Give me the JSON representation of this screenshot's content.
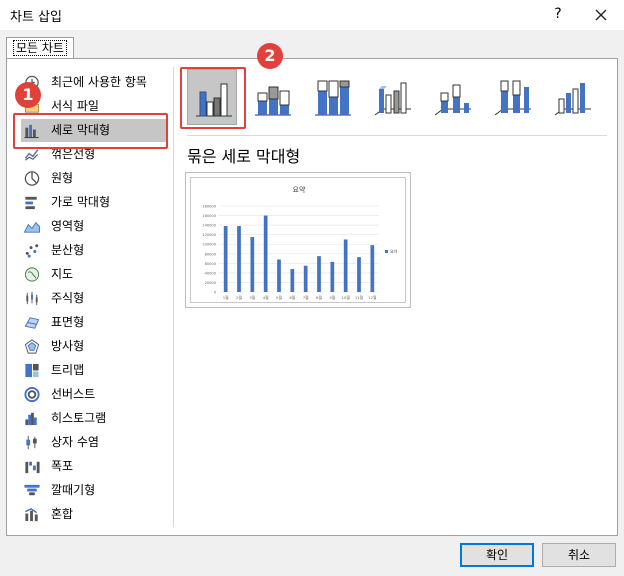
{
  "window": {
    "title": "차트 삽입",
    "help": "?"
  },
  "tabs": [
    {
      "label": "모든 차트",
      "active": true
    }
  ],
  "sidebar": {
    "items": [
      {
        "label": "최근에 사용한 항목",
        "icon": "recent-icon"
      },
      {
        "label": "서식 파일",
        "icon": "template-folder-icon"
      },
      {
        "label": "세로 막대형",
        "icon": "column-chart-icon",
        "selected": true
      },
      {
        "label": "꺾은선형",
        "icon": "line-chart-icon"
      },
      {
        "label": "원형",
        "icon": "pie-chart-icon"
      },
      {
        "label": "가로 막대형",
        "icon": "bar-chart-icon"
      },
      {
        "label": "영역형",
        "icon": "area-chart-icon"
      },
      {
        "label": "분산형",
        "icon": "scatter-chart-icon"
      },
      {
        "label": "지도",
        "icon": "map-chart-icon"
      },
      {
        "label": "주식형",
        "icon": "stock-chart-icon"
      },
      {
        "label": "표면형",
        "icon": "surface-chart-icon"
      },
      {
        "label": "방사형",
        "icon": "radar-chart-icon"
      },
      {
        "label": "트리맵",
        "icon": "treemap-icon"
      },
      {
        "label": "선버스트",
        "icon": "sunburst-icon"
      },
      {
        "label": "히스토그램",
        "icon": "histogram-icon"
      },
      {
        "label": "상자 수염",
        "icon": "box-whisker-icon"
      },
      {
        "label": "폭포",
        "icon": "waterfall-icon"
      },
      {
        "label": "깔때기형",
        "icon": "funnel-icon"
      },
      {
        "label": "혼합",
        "icon": "combo-chart-icon"
      }
    ]
  },
  "callouts": {
    "step1": "1",
    "step2": "2"
  },
  "chart_subtypes": {
    "selected_title": "묶은 세로 막대형",
    "items": [
      {
        "icon": "clustered-column-icon",
        "selected": true
      },
      {
        "icon": "stacked-column-icon"
      },
      {
        "icon": "100-stacked-column-icon"
      },
      {
        "icon": "3d-clustered-column-icon"
      },
      {
        "icon": "3d-stacked-column-icon"
      },
      {
        "icon": "3d-100-stacked-column-icon"
      },
      {
        "icon": "3d-column-icon"
      }
    ]
  },
  "chart_data": {
    "type": "bar",
    "title": "요약",
    "categories": [
      "1월",
      "2월",
      "3월",
      "4월",
      "5월",
      "6월",
      "7월",
      "8월",
      "9월",
      "10월",
      "11월",
      "12월"
    ],
    "series": [
      {
        "name": "요약",
        "values": [
          138000,
          138000,
          115000,
          160000,
          68000,
          48000,
          55000,
          75000,
          63000,
          110000,
          73000,
          98000
        ],
        "color": "#4472c4"
      }
    ],
    "ylim": [
      0,
      180000
    ],
    "yticks": [
      "0",
      "20000",
      "40000",
      "60000",
      "80000",
      "100000",
      "120000",
      "140000",
      "160000",
      "180000"
    ],
    "grid": true,
    "legend": "right"
  },
  "buttons": {
    "ok": "확인",
    "cancel": "취소"
  },
  "colors": {
    "accent": "#e0413b",
    "selection": "#c6c6c6",
    "focus": "#0078d7"
  }
}
